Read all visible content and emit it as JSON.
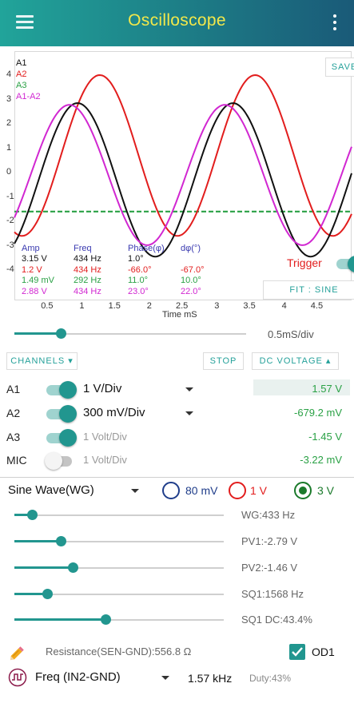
{
  "app": {
    "title": "Oscilloscope",
    "header_gradient": [
      "#21a49a",
      "#1a5a78"
    ],
    "title_color": "#f3e84a",
    "accent": "#21968f"
  },
  "plot": {
    "y_ticks": [
      "4",
      "3",
      "2",
      "1",
      "0",
      "-1",
      "-2",
      "-3",
      "-4"
    ],
    "x_ticks": [
      "0.5",
      "1",
      "1.5",
      "2",
      "2.5",
      "3",
      "3.5",
      "4",
      "4.5"
    ],
    "x_axis_label": "Time mS",
    "legend": [
      {
        "label": "A1",
        "color": "#111111"
      },
      {
        "label": "A2",
        "color": "#e21d1d"
      },
      {
        "label": "A3",
        "color": "#2aa145"
      },
      {
        "label": "A1-A2",
        "color": "#d127d1"
      }
    ],
    "save_label": "SAVE",
    "fit_label": "FIT : SINE",
    "trigger_label": "Trigger",
    "trigger_level": -1.6,
    "trigger_on": true,
    "params_header": {
      "amp": "Amp",
      "freq": "Freq",
      "phase": "Phase(φ)",
      "dphi": "dφ(°)"
    },
    "params_rows": [
      {
        "amp": "3.15 V",
        "freq": "434 Hz",
        "phase": "1.0°",
        "dphi": "",
        "color": "#111111"
      },
      {
        "amp": "1.2 V",
        "freq": "434 Hz",
        "phase": "-66.0°",
        "dphi": "-67.0°",
        "color": "#e21d1d"
      },
      {
        "amp": "1.49 mV",
        "freq": "292 Hz",
        "phase": "11.0°",
        "dphi": "10.0°",
        "color": "#2aa145"
      },
      {
        "amp": "2.88 V",
        "freq": "434 Hz",
        "phase": "23.0°",
        "dphi": "22.0°",
        "color": "#d127d1"
      }
    ]
  },
  "timebase": {
    "label": "0.5mS/div",
    "fraction": 0.2
  },
  "controls": {
    "channels_label": "CHANNELS ▾",
    "stop_label": "STOP",
    "dc_voltage_label": "DC VOLTAGE ▴"
  },
  "channels": [
    {
      "name": "A1",
      "on": true,
      "range": "1 V/Div",
      "value": "1.57 V",
      "has_dropdown": true
    },
    {
      "name": "A2",
      "on": true,
      "range": "300 mV/Div",
      "value": "-679.2 mV",
      "has_dropdown": true
    },
    {
      "name": "A3",
      "on": true,
      "range": "1 Volt/Div",
      "value": "-1.45 V",
      "has_dropdown": false
    },
    {
      "name": "MIC",
      "on": false,
      "range": "1 Volt/Div",
      "value": "-3.22 mV",
      "has_dropdown": false
    }
  ],
  "wavegen": {
    "mode": "Sine Wave(WG)",
    "amplitudes": [
      {
        "label": "80 mV",
        "color": "#1f3d8a",
        "selected": false
      },
      {
        "label": "1 V",
        "color": "#e21d1d",
        "selected": false
      },
      {
        "label": "3 V",
        "color": "#1b7a2b",
        "selected": true
      }
    ],
    "sliders": [
      {
        "label": "WG:433 Hz",
        "fraction": 0.085
      },
      {
        "label": "PV1:-2.79 V",
        "fraction": 0.22
      },
      {
        "label": "PV2:-1.46 V",
        "fraction": 0.28
      },
      {
        "label": "SQ1:1568 Hz",
        "fraction": 0.155
      },
      {
        "label": "SQ1 DC:43.4%",
        "fraction": 0.434
      }
    ]
  },
  "bottom": {
    "resistance": "Resistance(SEN-GND):556.8 Ω",
    "od1_label": "OD1",
    "od1_checked": true,
    "freq_select": "Freq (IN2-GND)",
    "freq_value": "1.57 kHz",
    "duty": "Duty:43%"
  }
}
